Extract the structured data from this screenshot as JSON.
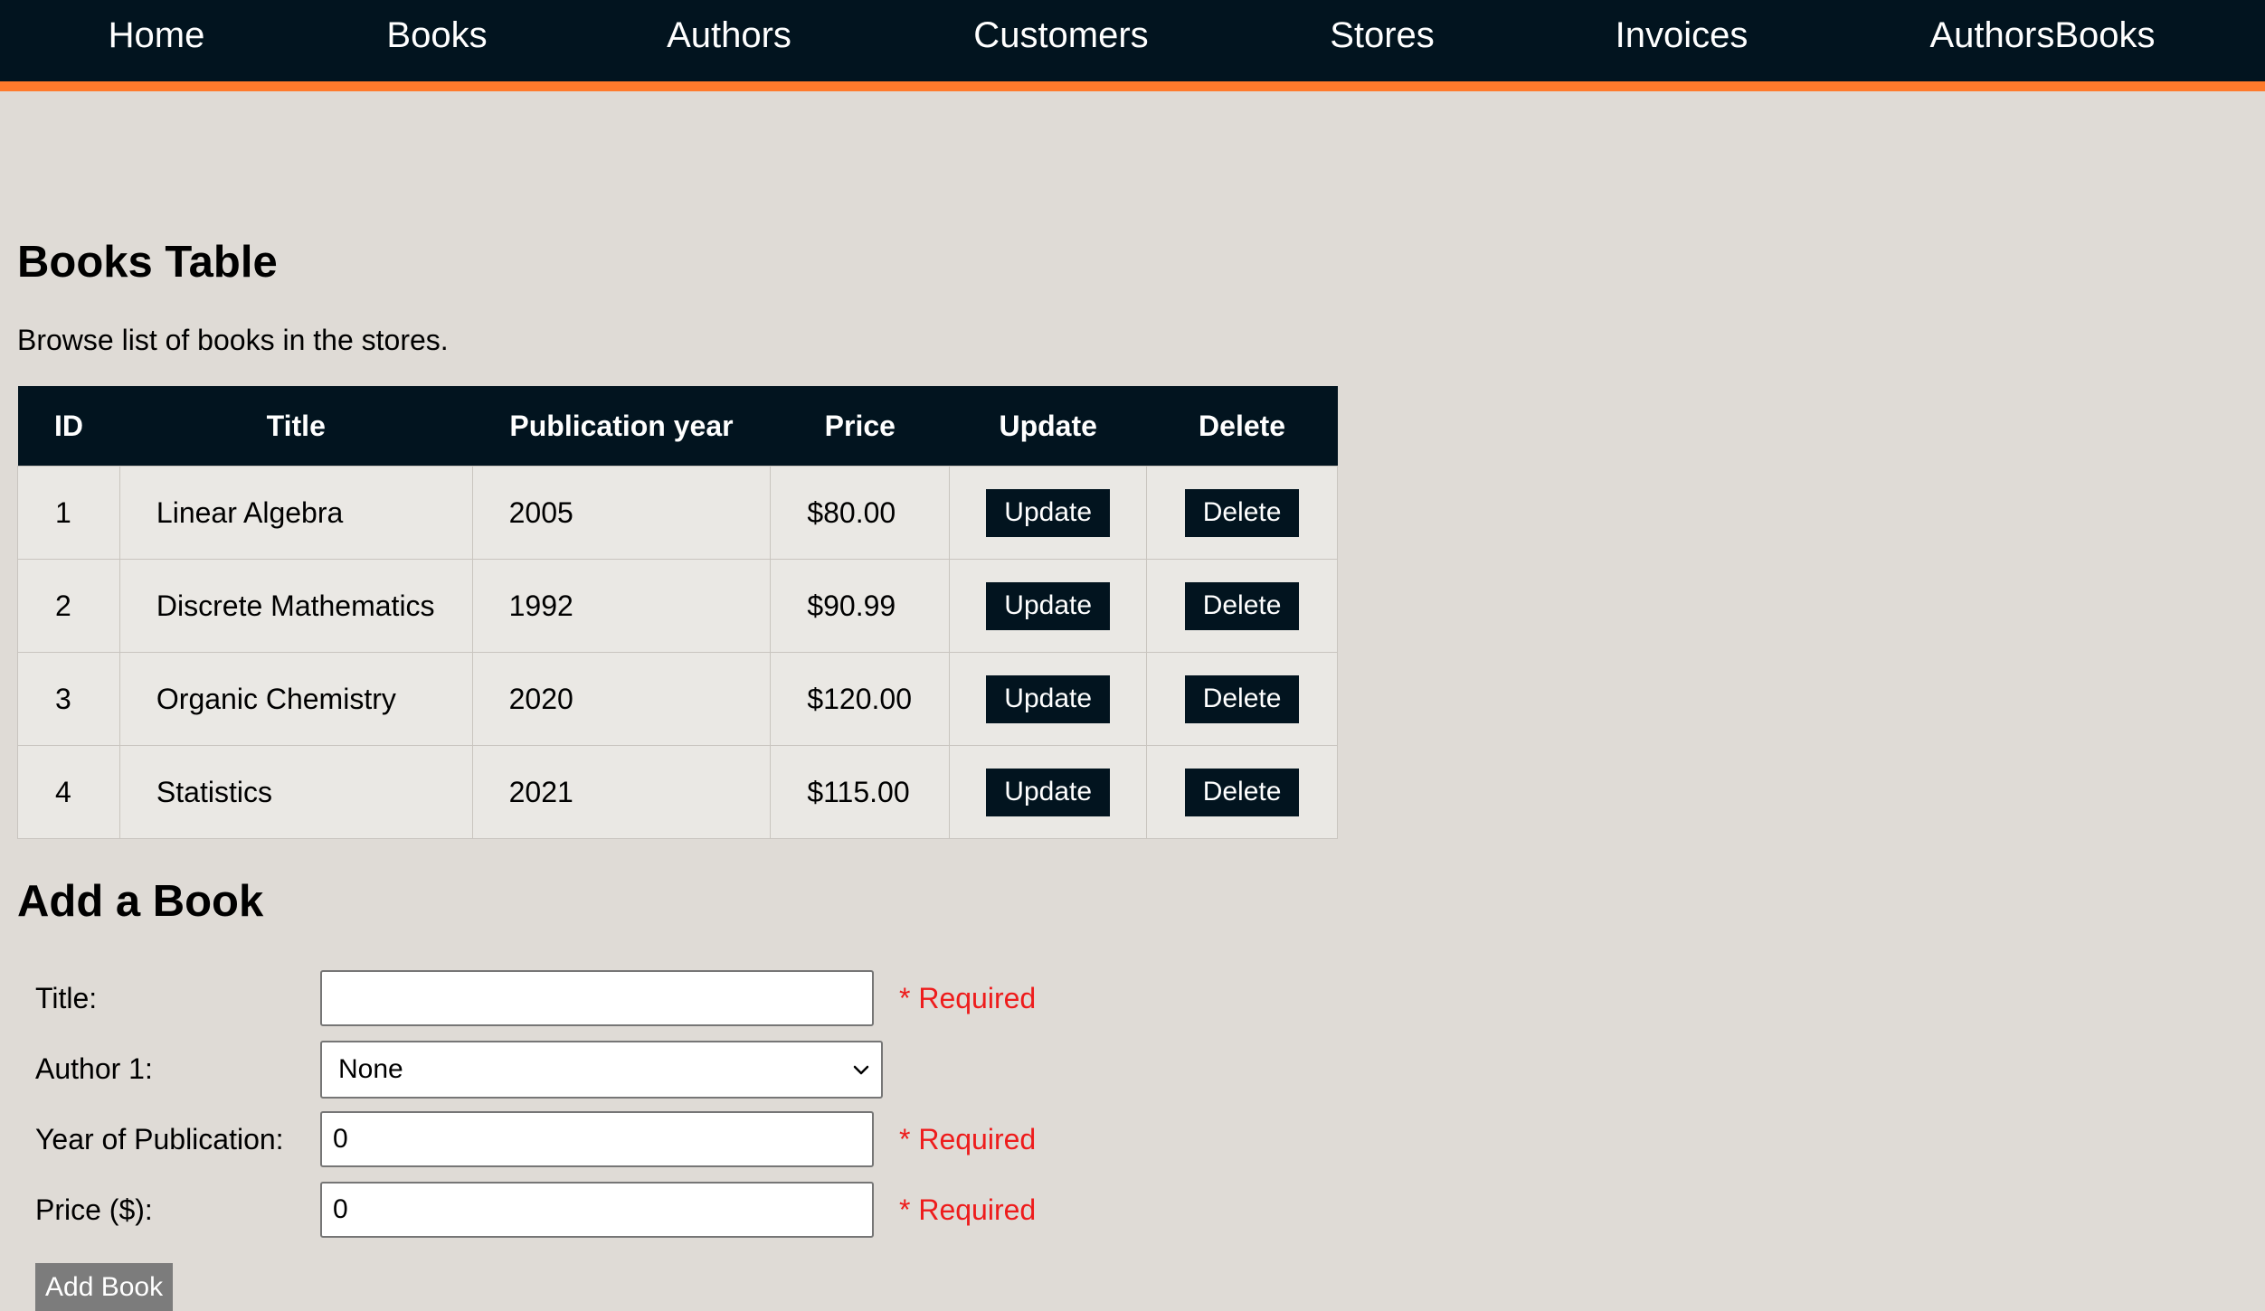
{
  "nav": {
    "home": "Home",
    "books": "Books",
    "authors": "Authors",
    "customers": "Customers",
    "stores": "Stores",
    "invoices": "Invoices",
    "authorsbooks": "AuthorsBooks"
  },
  "page": {
    "title": "Books Table",
    "description": "Browse list of books in the stores."
  },
  "table": {
    "headers": [
      "ID",
      "Title",
      "Publication year",
      "Price",
      "Update",
      "Delete"
    ],
    "rows": [
      {
        "id": "1",
        "title": "Linear Algebra",
        "year": "2005",
        "price": "$80.00",
        "update": "Update",
        "delete": "Delete"
      },
      {
        "id": "2",
        "title": "Discrete Mathematics",
        "year": "1992",
        "price": "$90.99",
        "update": "Update",
        "delete": "Delete"
      },
      {
        "id": "3",
        "title": "Organic Chemistry",
        "year": "2020",
        "price": "$120.00",
        "update": "Update",
        "delete": "Delete"
      },
      {
        "id": "4",
        "title": "Statistics",
        "year": "2021",
        "price": "$115.00",
        "update": "Update",
        "delete": "Delete"
      }
    ]
  },
  "form": {
    "title": "Add a Book",
    "title_label": "Title:",
    "title_value": "",
    "author_label": "Author 1:",
    "author_selected": "None",
    "year_label": "Year of Publication:",
    "year_value": "0",
    "price_label": "Price ($):",
    "price_value": "0",
    "required_text": "* Required",
    "submit_label": "Add Book"
  },
  "colors": {
    "nav_background": "#02141f",
    "nav_accent": "#ff7a2c",
    "page_background": "#dfdbd6",
    "required": "#ee1c1c",
    "submit_background": "#7c7c7c"
  },
  "icons": {
    "select_arrow": "chevron-down-icon"
  }
}
